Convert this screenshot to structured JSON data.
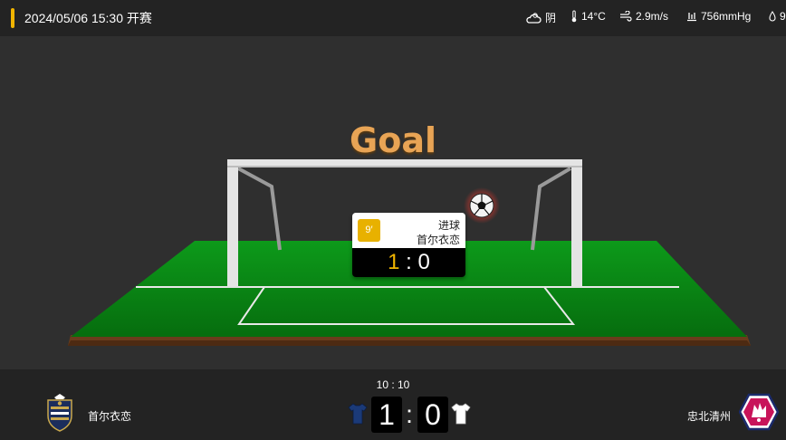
{
  "header": {
    "datetime": "2024/05/06 15:30 开赛",
    "weather": {
      "condition": "阴",
      "temperature": "14°C",
      "wind": "2.9m/s",
      "pressure": "756mmHg",
      "extra": "9"
    }
  },
  "scene": {
    "title": "Goal",
    "popup": {
      "minute": "9′",
      "event": "进球",
      "team": "首尔衣恋",
      "home_score": "1",
      "separator": ":",
      "away_score": "0"
    }
  },
  "scoreboard": {
    "clock": "10 : 10",
    "home_team": "首尔衣恋",
    "away_team": "忠北清州",
    "home_score": "1",
    "separator": ":",
    "away_score": "0",
    "home_kit_color": "#1b3a78",
    "away_kit_color": "#ffffff"
  },
  "colors": {
    "accent": "#f0b400",
    "title": "#e8a455",
    "pitch": "#0b8a16",
    "away_badge": "#c8145a"
  }
}
